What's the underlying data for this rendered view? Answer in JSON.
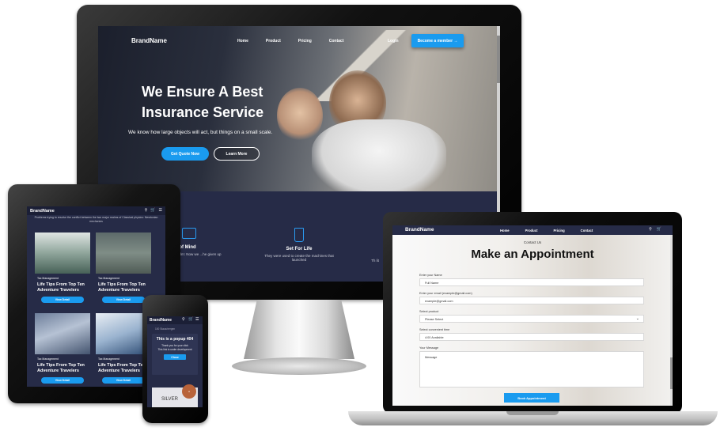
{
  "desktop": {
    "brand": "BrandName",
    "nav": [
      "Home",
      "Product",
      "Pricing",
      "Contact"
    ],
    "login": "Login",
    "cta": "Become a member →",
    "hero_title": "We Ensure A Best Insurance Service",
    "hero_subtitle": "We know how large objects will act, but things on a small scale.",
    "btn_quote": "Get Quote Now",
    "btn_learn": "Learn More",
    "features": [
      {
        "title": "ce of Mind",
        "text": "es the realm: Now we ...he given up"
      },
      {
        "title": "Set For Life",
        "text": "They were used to create the machines that launched"
      },
      {
        "title": "",
        "text": "Th lit"
      }
    ]
  },
  "tablet": {
    "brand": "BrandName",
    "hint": "Problems trying to resolve the conflict between the two major realms of Classical physics: Newtonian mechanics",
    "cards": [
      {
        "category": "Tax Management",
        "title": "Life Tips From Top Ten Adventure Travelers",
        "button": "View Detail"
      },
      {
        "category": "Tax Management",
        "title": "Life Tips From Top Ten Adventure Travelers",
        "button": "View Detail"
      },
      {
        "category": "Tax Management",
        "title": "Life Tips From Top Ten Adventure Travelers",
        "button": "View Detail"
      },
      {
        "category": "Tax Management",
        "title": "Life Tips From Top Ten Adventure Travelers",
        "button": "View Detail"
      }
    ]
  },
  "phone": {
    "brand": "BrandName",
    "menu_hint": "100 Staus/nergen",
    "popup_title": "This is a popup 404",
    "popup_text1": "Thank you for your click",
    "popup_text2": "This link is under development",
    "popup_button": "Close",
    "plan": "SILVER"
  },
  "laptop": {
    "brand": "BrandName",
    "nav": [
      "Home",
      "Product",
      "Pricing",
      "Contact"
    ],
    "contact_us": "Contact Us",
    "title": "Make an Appointment",
    "fields": [
      {
        "label": "Enter your Name",
        "value": "Full Name"
      },
      {
        "label": "Enter your email (example@gmail.com)",
        "value": "example@gmail.com"
      },
      {
        "label": "Select product",
        "value": "Please Select"
      },
      {
        "label": "Select convenient time",
        "value": "4:00 Available"
      }
    ],
    "message_label": "Your Message",
    "message_placeholder": "Message",
    "submit": "Book Appointment"
  }
}
